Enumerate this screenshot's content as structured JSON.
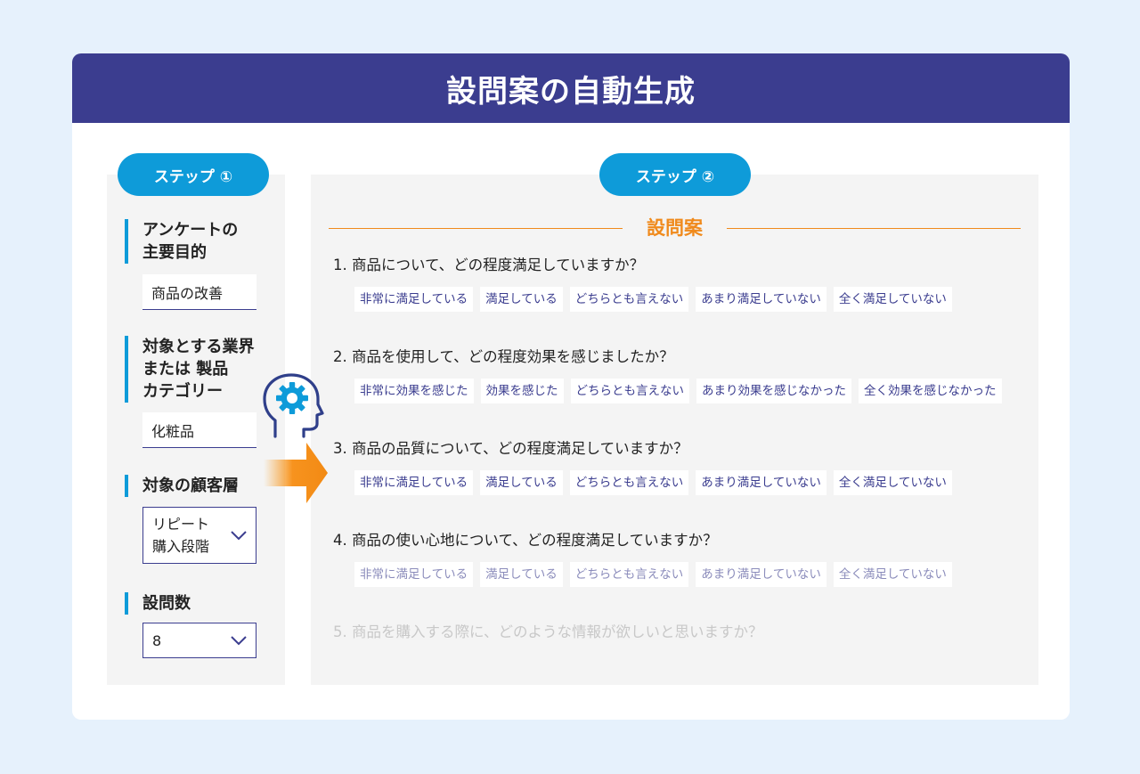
{
  "header": {
    "title": "設問案の自動生成"
  },
  "step1": {
    "label": "ステップ ①",
    "fields": [
      {
        "label_lines": [
          "アンケートの",
          "主要目的"
        ],
        "value": "商品の改善"
      },
      {
        "label_lines": [
          "対象とする業界",
          "または 製品",
          "カテゴリー"
        ],
        "value": "化粧品"
      },
      {
        "label_lines": [
          "対象の顧客層"
        ],
        "value_lines": [
          "リピート",
          "購入段階"
        ]
      },
      {
        "label_lines": [
          "設問数"
        ],
        "value": "8"
      }
    ]
  },
  "step2": {
    "label": "ステップ ②",
    "section_title": "設問案",
    "questions": [
      {
        "text": "1. 商品について、どの程度満足していますか？",
        "options": [
          "非常に満足している",
          "満足している",
          "どちらとも言えない",
          "あまり満足していない",
          "全く満足していない"
        ]
      },
      {
        "text": "2. 商品を使用して、どの程度効果を感じましたか？",
        "options": [
          "非常に効果を感じた",
          "効果を感じた",
          "どちらとも言えない",
          "あまり効果を感じなかった",
          "全く効果を感じなかった"
        ]
      },
      {
        "text": "3. 商品の品質について、どの程度満足していますか？",
        "options": [
          "非常に満足している",
          "満足している",
          "どちらとも言えない",
          "あまり満足していない",
          "全く満足していない"
        ]
      },
      {
        "text": "4. 商品の使い心地について、どの程度満足していますか？",
        "options": [
          "非常に満足している",
          "満足している",
          "どちらとも言えない",
          "あまり満足していない",
          "全く満足していない"
        ]
      },
      {
        "text": "5. 商品を購入する際に、どのような情報が欲しいと思いますか？"
      }
    ]
  },
  "icons": {
    "ai": "gear-head-icon",
    "flow": "arrow-right-icon",
    "dropdown": "chevron-down-icon"
  },
  "colors": {
    "header": "#3b3d8f",
    "accent": "#0e9bd9",
    "orange": "#f08a1c"
  }
}
